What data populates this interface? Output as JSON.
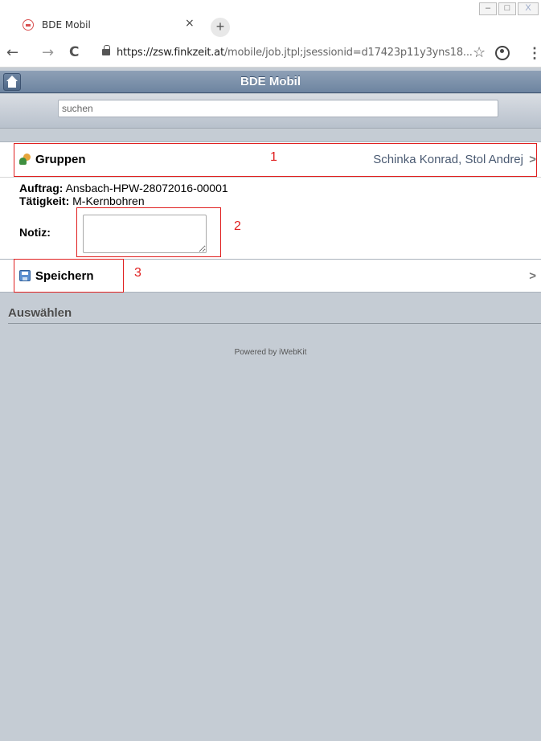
{
  "browser": {
    "tab_title": "BDE Mobil",
    "tab_close": "×",
    "new_tab": "+",
    "url_host": "https://zsw.finkzeit.at",
    "url_path": "/mobile/job.jtpl;jsessionid=d17423p11y3yns18...",
    "back": "←",
    "forward": "→",
    "reload": "C",
    "star": "☆",
    "menu": "⋮",
    "win_min": "–",
    "win_max": "□",
    "win_close": "X"
  },
  "app": {
    "title": "BDE Mobil",
    "search_placeholder": "suchen"
  },
  "groups": {
    "label": "Gruppen",
    "value": "Schinka Konrad, Stol Andrej",
    "chevron": ">"
  },
  "job": {
    "auftrag_label": "Auftrag:",
    "auftrag_value": "Ansbach-HPW-28072016-00001",
    "taetigkeit_label": "Tätigkeit:",
    "taetigkeit_value": "M-Kernbohren",
    "notiz_label": "Notiz:"
  },
  "save": {
    "label": "Speichern",
    "chevron": ">"
  },
  "section_title": "Auswählen",
  "footer": "Powered by iWebKit",
  "annotations": [
    "1",
    "2",
    "3"
  ]
}
